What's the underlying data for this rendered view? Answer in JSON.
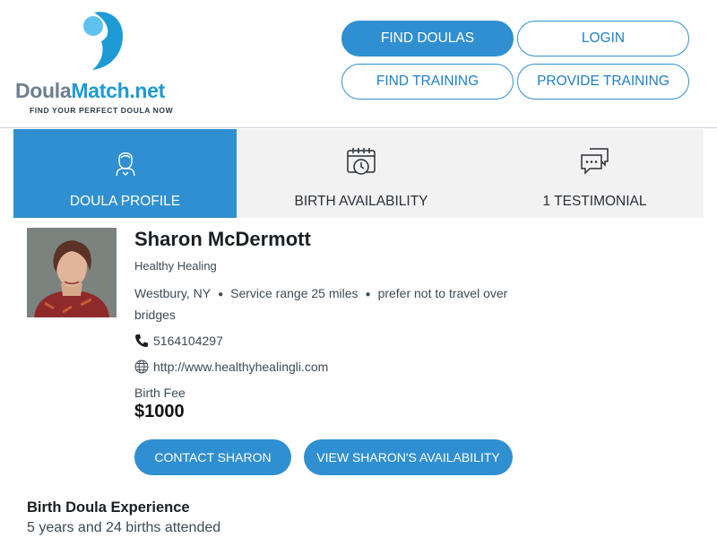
{
  "logo": {
    "part1": "Doula",
    "part2": "Match.net",
    "tagline": "FIND YOUR PERFECT DOULA NOW",
    "brand_blue": "#1d9ad6",
    "brand_gray": "#6b7f91"
  },
  "nav": {
    "find_doulas": "FIND DOULAS",
    "login": "LOGIN",
    "find_training": "FIND TRAINING",
    "provide_training": "PROVIDE TRAINING"
  },
  "tabs": [
    {
      "label": "DOULA PROFILE",
      "icon": "person-icon",
      "active": true
    },
    {
      "label": "BIRTH AVAILABILITY",
      "icon": "calendar-clock-icon",
      "active": false
    },
    {
      "label": "1 TESTIMONIAL",
      "icon": "chat-bubbles-icon",
      "active": false
    }
  ],
  "profile": {
    "name": "Sharon McDermott",
    "business": "Healthy Healing",
    "location": "Westbury, NY",
    "service_range": "Service range 25 miles",
    "travel_note": "prefer not to travel over bridges",
    "phone": "5164104297",
    "website": "http://www.healthyhealingli.com",
    "fee_label": "Birth Fee",
    "fee_value": "$1000"
  },
  "actions": {
    "contact": "CONTACT SHARON",
    "availability": "VIEW SHARON'S AVAILABILITY"
  },
  "experience": {
    "title": "Birth Doula Experience",
    "text": "5 years and 24 births attended"
  },
  "colors": {
    "accent": "#2f8fd0",
    "tab_bg": "#f2f2f2"
  }
}
